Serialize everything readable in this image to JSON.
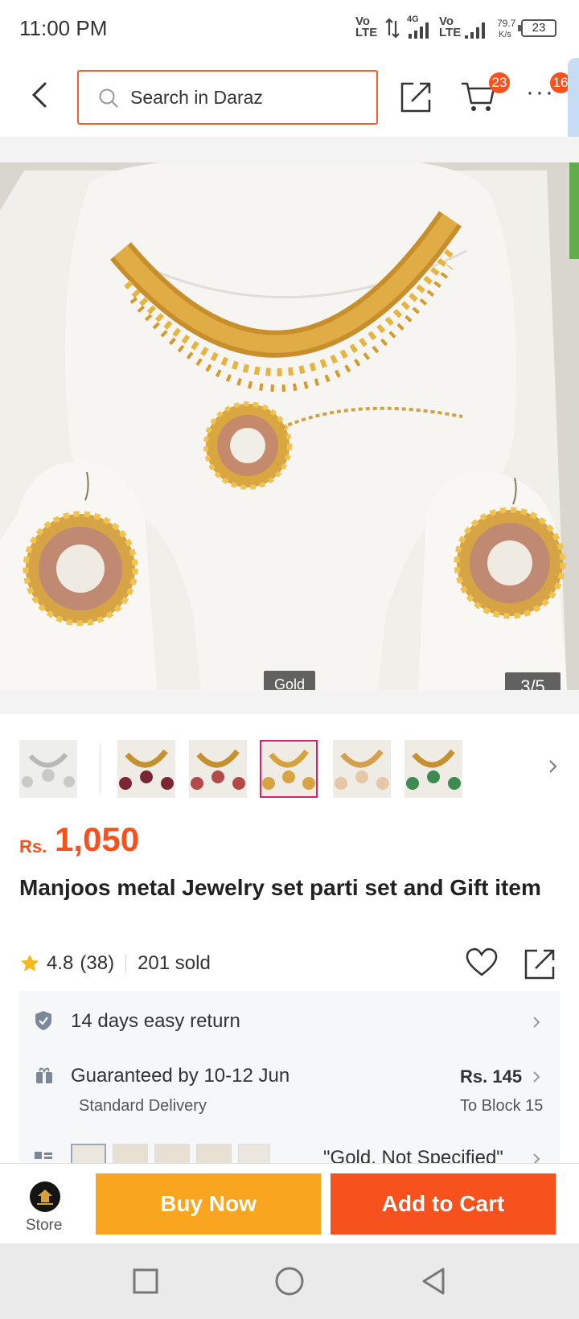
{
  "status_bar": {
    "time": "11:00 PM",
    "net1": "Vo LTE",
    "net2": "4G",
    "net3": "Vo LTE",
    "speed_value": "79.7",
    "speed_unit": "K/s",
    "battery": "23"
  },
  "header": {
    "search_placeholder": "Search in Daraz",
    "cart_count": "23",
    "more_count": "16"
  },
  "gallery": {
    "variant_label": "Gold",
    "counter": "3/5",
    "active_index": 3
  },
  "product": {
    "currency": "Rs.",
    "price": "1,050",
    "title": "Manjoos metal Jewelry set parti set and Gift item",
    "rating": "4.8",
    "rating_count": "(38)",
    "sold": "201 sold"
  },
  "services": {
    "return_text": "14 days easy return",
    "delivery_text": "Guaranteed by 10-12 Jun",
    "delivery_method": "Standard Delivery",
    "delivery_fee": "Rs. 145",
    "delivery_location": "To Block 15",
    "variant_text": "\"Gold, Not Specified\""
  },
  "bottom_bar": {
    "store_label": "Store",
    "buy_now": "Buy Now",
    "add_to_cart": "Add to Cart"
  },
  "colors": {
    "accent": "#f7521e",
    "buy_now": "#f9a51f",
    "thumb_active": "#d3226b"
  }
}
